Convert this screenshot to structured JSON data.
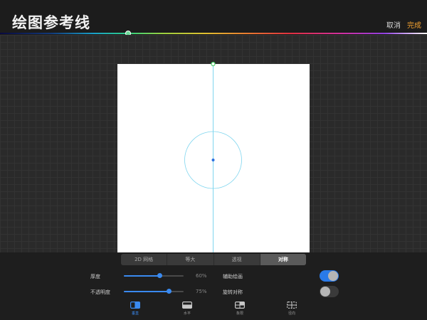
{
  "header": {
    "title": "绘图参考线",
    "cancel_label": "取消",
    "done_label": "完成"
  },
  "color_slider": {
    "position": 0.3,
    "knob_color": "#6edb9a"
  },
  "guide": {
    "color": "#7fd6ef",
    "handle_color": "#4ccf6a",
    "center_color": "#2a6fe0"
  },
  "tabs": [
    {
      "label": "2D 网格",
      "active": false
    },
    {
      "label": "等大",
      "active": false
    },
    {
      "label": "透视",
      "active": false
    },
    {
      "label": "对称",
      "active": true
    }
  ],
  "settings": {
    "thickness": {
      "label": "厚度",
      "value": 60,
      "value_text": "60%"
    },
    "opacity": {
      "label": "不透明度",
      "value": 75,
      "value_text": "75%"
    },
    "assisted_drawing": {
      "label": "辅助绘画",
      "on": true
    },
    "rotational_symmetry": {
      "label": "旋转对称",
      "on": false
    }
  },
  "modes": [
    {
      "label": "垂直",
      "icon": "vertical-icon",
      "active": true
    },
    {
      "label": "水平",
      "icon": "horizontal-icon",
      "active": false
    },
    {
      "label": "象限",
      "icon": "quadrant-icon",
      "active": false
    },
    {
      "label": "径向",
      "icon": "radial-icon",
      "active": false
    }
  ],
  "accent_color": "#3a8af0",
  "done_color": "#f0a030"
}
